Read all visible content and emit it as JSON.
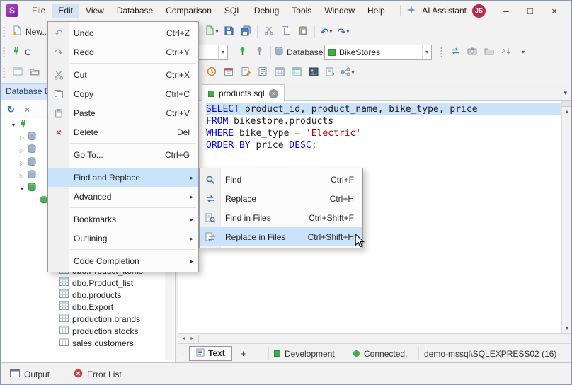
{
  "colors": {
    "accent_blue": "#2f71c1",
    "keyword_blue": "#0000ff",
    "string_red": "#c00000",
    "selection_blue": "#cbe2f8",
    "status_green": "#3fae49",
    "badge_red": "#c2274b",
    "logo_purple": "#8e2da5"
  },
  "menubar": {
    "logo_letter": "S",
    "items": [
      "File",
      "Edit",
      "View",
      "Database",
      "Comparison",
      "SQL",
      "Debug",
      "Tools",
      "Window",
      "Help"
    ],
    "active_item": "Edit",
    "ai_assistant_label": "AI Assistant",
    "user_badge": "JS",
    "window_controls": {
      "minimize": "–",
      "maximize": "□",
      "close": "×"
    }
  },
  "toolbars": {
    "new_label": "New...",
    "connect_partial_label": "C",
    "database_label": "Database",
    "database_selected": "BikeStores"
  },
  "edit_menu": {
    "items": [
      {
        "label": "Undo",
        "shortcut": "Ctrl+Z"
      },
      {
        "label": "Redo",
        "shortcut": "Ctrl+Y"
      },
      {
        "label": "Cut",
        "shortcut": "Ctrl+X"
      },
      {
        "label": "Copy",
        "shortcut": "Ctrl+C"
      },
      {
        "label": "Paste",
        "shortcut": "Ctrl+V"
      },
      {
        "label": "Delete",
        "shortcut": "Del"
      },
      {
        "label": "Go To...",
        "shortcut": "Ctrl+G"
      },
      {
        "label": "Find and Replace"
      },
      {
        "label": "Advanced"
      },
      {
        "label": "Bookmarks"
      },
      {
        "label": "Outlining"
      },
      {
        "label": "Code Completion"
      }
    ]
  },
  "find_submenu": {
    "items": [
      {
        "label": "Find",
        "shortcut": "Ctrl+F"
      },
      {
        "label": "Replace",
        "shortcut": "Ctrl+H"
      },
      {
        "label": "Find in Files",
        "shortcut": "Ctrl+Shift+F"
      },
      {
        "label": "Replace in Files",
        "shortcut": "Ctrl+Shift+H"
      }
    ]
  },
  "explorer": {
    "tab_title": "Database E",
    "tables": [
      "dbo.Product_items",
      "dbo.Product_list",
      "dbo.products",
      "dbo.Export",
      "production.brands",
      "production.stocks",
      "sales.customers"
    ]
  },
  "editor": {
    "tab_title": "products.sql",
    "lines": [
      {
        "tokens": [
          {
            "text": "SELECT"
          },
          {
            "text": " product_id, product_name, bike_type, price"
          }
        ]
      },
      {
        "tokens": [
          {
            "text": "FROM"
          },
          {
            "text": " bikestore.products"
          }
        ]
      },
      {
        "tokens": [
          {
            "text": "WHERE"
          },
          {
            "text": " bike_type "
          },
          {
            "text": "= "
          },
          {
            "text": "'Electric'"
          }
        ]
      },
      {
        "tokens": [
          {
            "text": "ORDER BY"
          },
          {
            "text": " price "
          },
          {
            "text": "DESC"
          },
          {
            "text": ";"
          }
        ]
      }
    ]
  },
  "statusbar": {
    "view_tab": "Text",
    "add_tab": "+",
    "environment": "Development",
    "connection_status": "Connected.",
    "server": "demo-mssql\\SQLEXPRESS02 (16)"
  },
  "bottom_bar": {
    "output": "Output",
    "error_list": "Error List"
  }
}
